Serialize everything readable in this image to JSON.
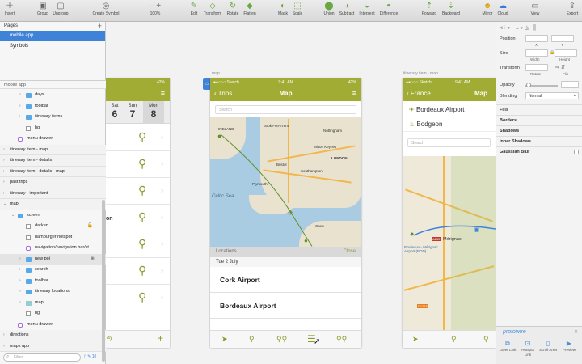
{
  "toolbar": {
    "insert": "Insert",
    "group": "Group",
    "ungroup": "Ungroup",
    "create_symbol": "Create Symbol",
    "zoom_minus": "–",
    "zoom_plus": "+",
    "zoom_level": "100%",
    "edit": "Edit",
    "transform": "Transform",
    "rotate": "Rotate",
    "flatten": "Flatten",
    "mask": "Mask",
    "scale": "Scale",
    "union": "Union",
    "subtract": "Subtract",
    "intersect": "Intersect",
    "difference": "Difference",
    "forward": "Forward",
    "backward": "Backward",
    "mirror": "Mirror",
    "cloud": "Cloud",
    "view": "View",
    "export": "Export"
  },
  "pages": {
    "header": "Pages",
    "items": [
      "mobile app",
      "Symbols"
    ]
  },
  "layers": {
    "header": "mobile app",
    "rows": [
      {
        "label": "days",
        "indent": 2,
        "icon": "folder",
        "arrow": "›"
      },
      {
        "label": "toolbar",
        "indent": 2,
        "icon": "folder",
        "arrow": "›"
      },
      {
        "label": "itinerary items",
        "indent": 2,
        "icon": "folder",
        "arrow": "›"
      },
      {
        "label": "bg",
        "indent": 2,
        "icon": "rect",
        "arrow": ""
      },
      {
        "label": "menu drawer",
        "indent": 1,
        "icon": "sym",
        "arrow": ""
      },
      {
        "label": "itinerary item - map",
        "indent": 0,
        "icon": "",
        "arrow": "›",
        "group": true
      },
      {
        "label": "itinerary item - details",
        "indent": 0,
        "icon": "",
        "arrow": "›",
        "group": true
      },
      {
        "label": "itinerary item - details - map",
        "indent": 0,
        "icon": "",
        "arrow": "›",
        "group": true
      },
      {
        "label": "past trips",
        "indent": 0,
        "icon": "",
        "arrow": "›",
        "group": true
      },
      {
        "label": "itinerary - important",
        "indent": 0,
        "icon": "",
        "arrow": "›",
        "group": true
      },
      {
        "label": "map",
        "indent": 0,
        "icon": "",
        "arrow": "⌄",
        "group": true
      },
      {
        "label": "screen",
        "indent": 1,
        "icon": "folder",
        "arrow": "⌄"
      },
      {
        "label": "darken",
        "indent": 2,
        "icon": "rect",
        "arrow": "",
        "lock": true
      },
      {
        "label": "hamburger hotspot",
        "indent": 2,
        "icon": "rect",
        "arrow": ""
      },
      {
        "label": "navigation/navigation bar/st...",
        "indent": 2,
        "icon": "sym",
        "arrow": ""
      },
      {
        "label": "new poi",
        "indent": 2,
        "icon": "folder",
        "arrow": "›",
        "eye": true,
        "hl": true
      },
      {
        "label": "search",
        "indent": 2,
        "icon": "folder",
        "arrow": "›"
      },
      {
        "label": "toolbar",
        "indent": 2,
        "icon": "folder",
        "arrow": "›"
      },
      {
        "label": "itinerary locations",
        "indent": 2,
        "icon": "folder",
        "arrow": "›"
      },
      {
        "label": "map",
        "indent": 2,
        "icon": "img",
        "arrow": "›"
      },
      {
        "label": "bg",
        "indent": 2,
        "icon": "rect",
        "arrow": ""
      },
      {
        "label": "menu drawer",
        "indent": 1,
        "icon": "sym",
        "arrow": ""
      },
      {
        "label": "directions",
        "indent": 0,
        "icon": "",
        "arrow": "›",
        "group": true
      },
      {
        "label": "maps app",
        "indent": 0,
        "icon": "",
        "arrow": "›",
        "group": true
      }
    ],
    "filter_placeholder": "Filter",
    "filter_count": "10"
  },
  "canvas": {
    "left_phone": {
      "battery": "42%",
      "days": [
        {
          "dow": "Sat",
          "num": "6"
        },
        {
          "dow": "Sun",
          "num": "7"
        },
        {
          "dow": "Mon",
          "num": "8"
        }
      ],
      "partial_text": "on",
      "partial_tab": "ay",
      "add": "+"
    },
    "map_phone": {
      "artboard_label": "map",
      "carrier": "●●○○○ Sketch",
      "time": "9:41 AM",
      "battery": "42%",
      "back": "Trips",
      "title": "Map",
      "search_placeholder": "Search",
      "map_labels": [
        "IRELAND",
        "Stoke-on-Trent",
        "Nottingham",
        "Milton Keynes",
        "LONDON",
        "Bristol",
        "Southampton",
        "Plymouth",
        "Celtic Sea",
        "Caen"
      ],
      "sheet_header": "Locations",
      "sheet_close": "Close",
      "sheet_date": "Tue 2 July",
      "locations": [
        "Cork Airport",
        "Bordeaux Airport"
      ]
    },
    "detail_phone": {
      "artboard_label": "itinerary item - map",
      "carrier": "●●○○○ Sketch",
      "time": "9:41 AM",
      "back": "France",
      "title": "Map",
      "from": "Bordeaux Airport",
      "to": "Bodgeon",
      "search_placeholder": "Search",
      "map_labels": [
        "Mérignac",
        "Bordeaux - Mérignac Airport (BOD)",
        "A630",
        "D1215"
      ]
    }
  },
  "inspector": {
    "position": "Position",
    "size": "Size",
    "transform": "Transform",
    "x": "X",
    "y": "Y",
    "width": "Width",
    "height": "Height",
    "rotate": "Rotate",
    "flip": "Flip",
    "opacity": "Opacity",
    "blending": "Blending",
    "blending_value": "Normal",
    "fills": "Fills",
    "borders": "Borders",
    "shadows": "Shadows",
    "inner_shadows": "Inner Shadows",
    "gaussian_blur": "Gaussian Blur",
    "protowire": {
      "brand": "protowire",
      "layer_link": "Layer Link",
      "hotspot_link": "Hotspot Link",
      "scroll_area": "Scroll Area",
      "preview": "Preview"
    }
  }
}
